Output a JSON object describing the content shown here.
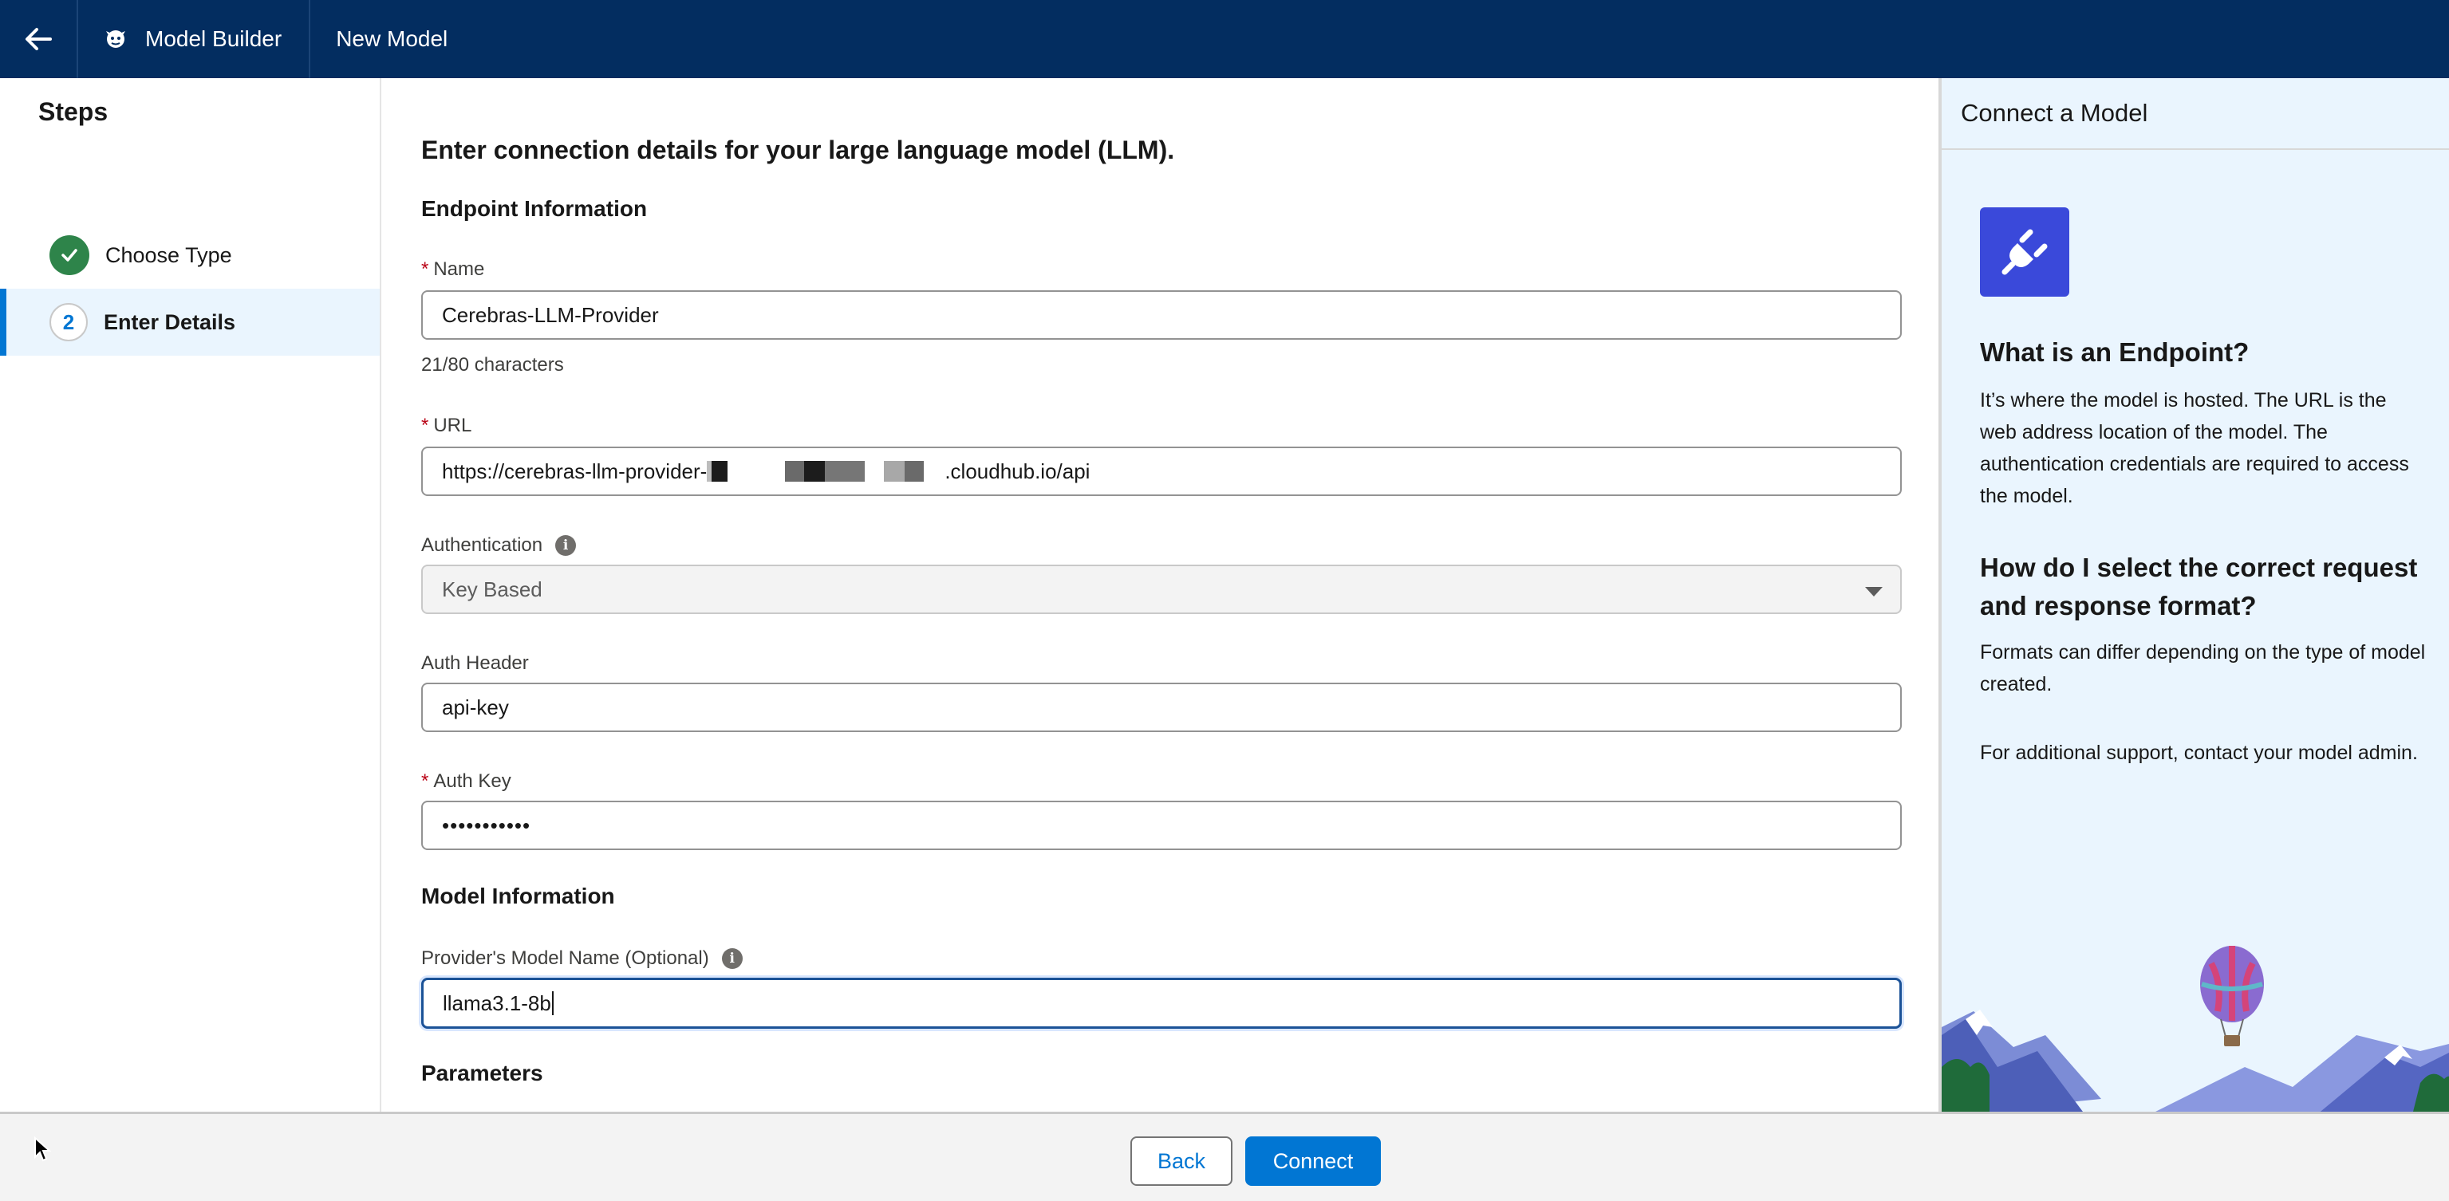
{
  "topbar": {
    "app_label": "Model Builder",
    "tab_label": "New Model"
  },
  "steps": {
    "title": "Steps",
    "items": [
      {
        "label": "Choose Type",
        "status": "complete"
      },
      {
        "number": "2",
        "label": "Enter Details",
        "status": "current"
      }
    ]
  },
  "form": {
    "heading": "Enter connection details for your large language model (LLM).",
    "endpoint_section": "Endpoint Information",
    "name": {
      "label": "Name",
      "required": "*",
      "value": "Cerebras-LLM-Provider",
      "counter": "21/80 characters"
    },
    "url": {
      "label": "URL",
      "required": "*",
      "value_prefix": "https://cerebras-llm-provider-",
      "value_suffix": ".cloudhub.io/api"
    },
    "authentication": {
      "label": "Authentication",
      "value": "Key Based"
    },
    "auth_header": {
      "label": "Auth Header",
      "value": "api-key"
    },
    "auth_key": {
      "label": "Auth Key",
      "required": "*",
      "value": "•••••••••••"
    },
    "model_section": "Model Information",
    "model_name": {
      "label": "Provider's Model Name (Optional)",
      "value": "llama3.1-8b"
    },
    "parameters_section": "Parameters"
  },
  "panel": {
    "title": "Connect a Model",
    "icon": "plug-icon",
    "q1": "What is an Endpoint?",
    "a1": "It’s where the model is hosted. The URL is the web address location of the model. The authentication credentials are required to access the model.",
    "q2": "How do I select the correct request and response format?",
    "a2": "Formats can differ depending on the type of model created.",
    "a3": "For additional support, contact your model admin."
  },
  "footer": {
    "back_label": "Back",
    "connect_label": "Connect"
  },
  "colors": {
    "topbar": "#032d60",
    "brand": "#0176d3",
    "success": "#2e844a",
    "required": "#ba0517",
    "panel_bg": "#eaf5fe",
    "icon_bg": "#3a49da"
  }
}
